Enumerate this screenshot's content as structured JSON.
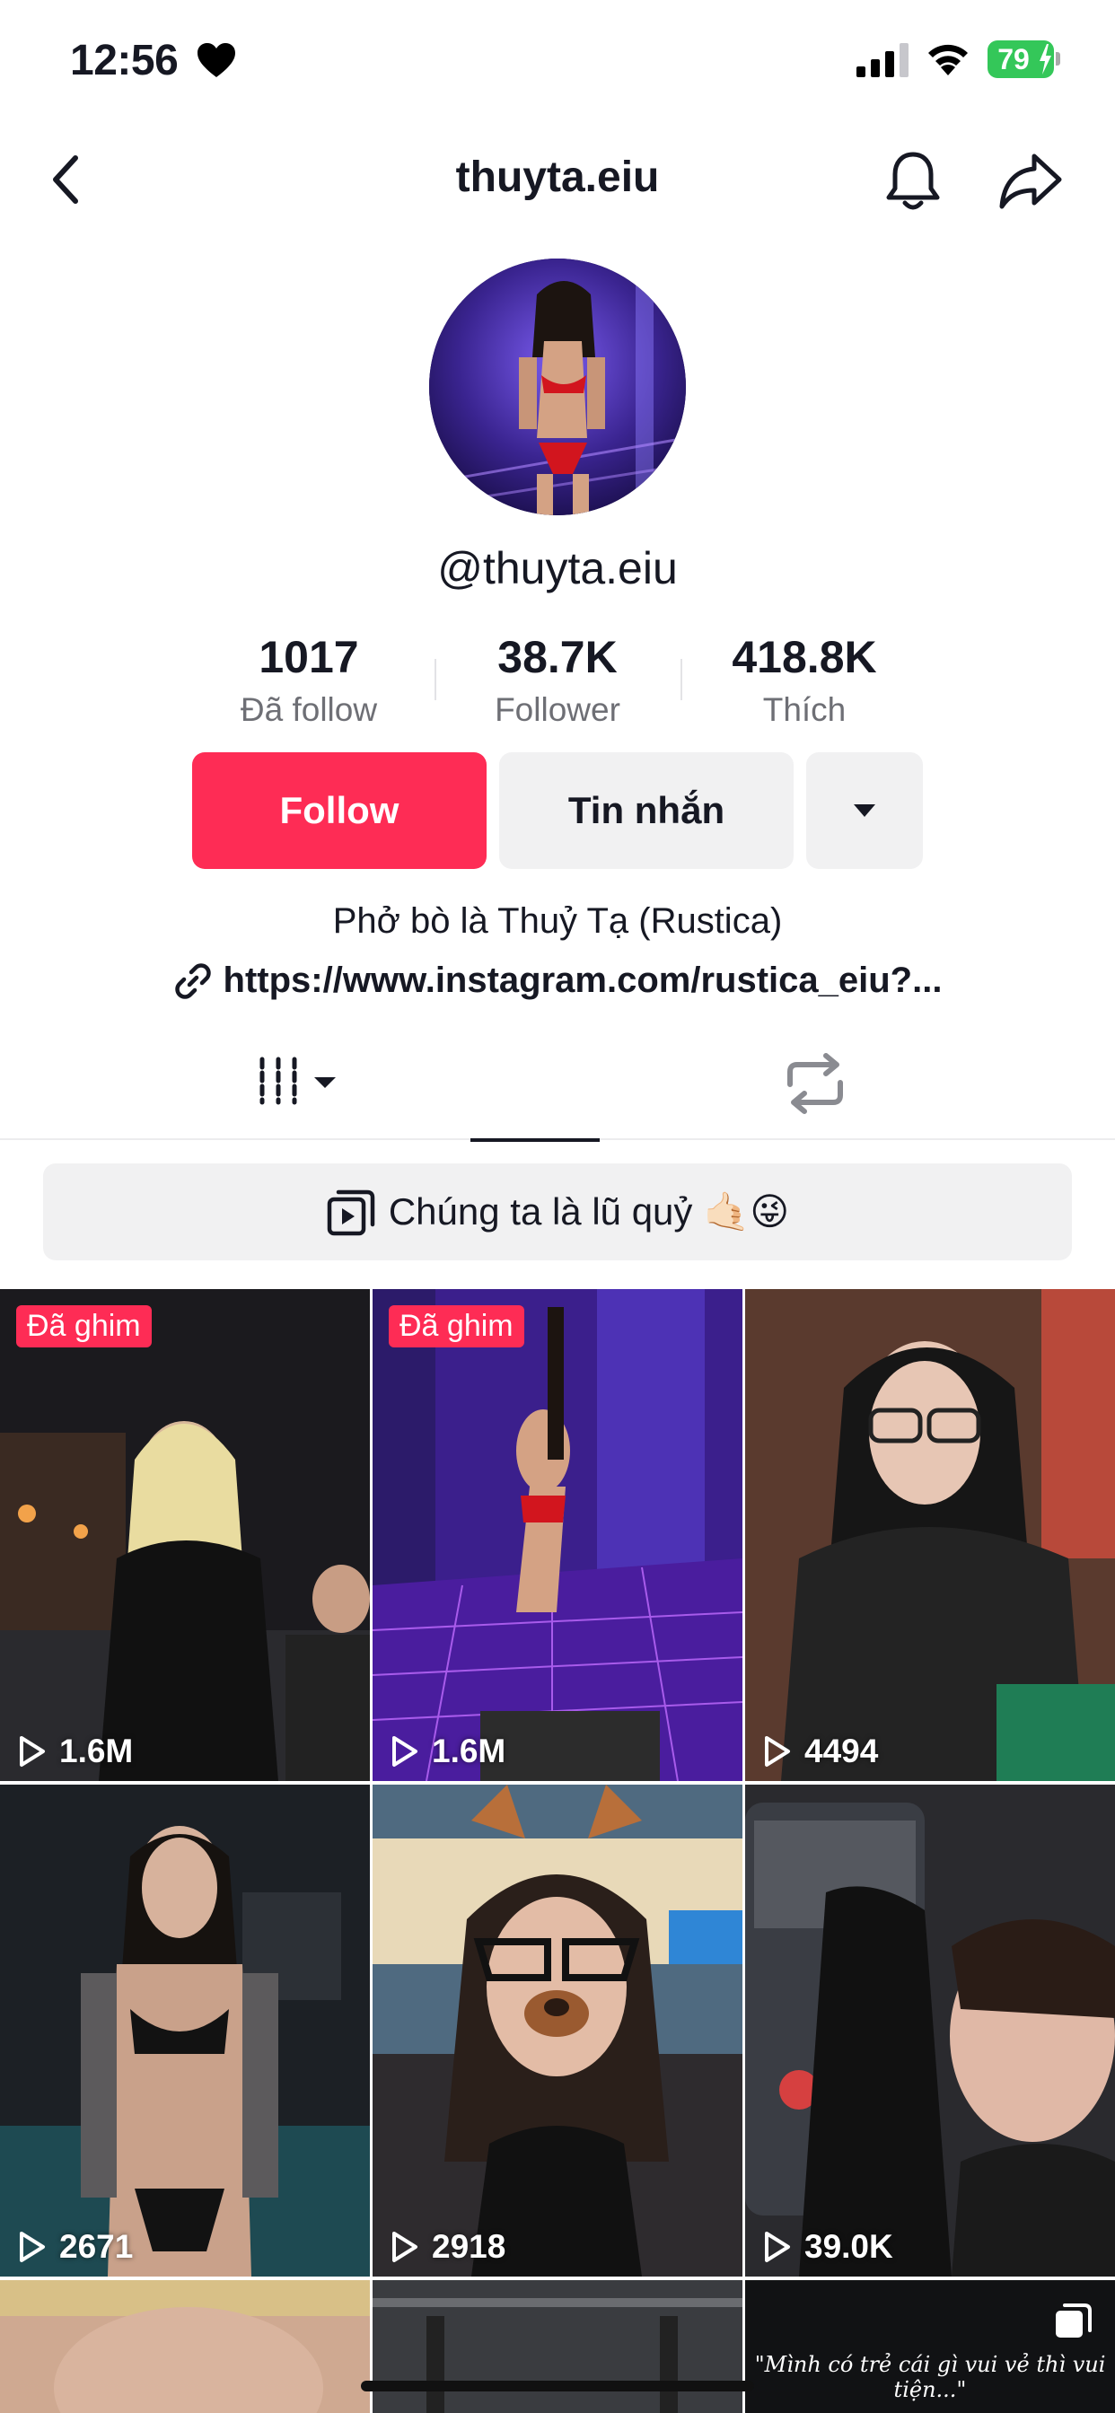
{
  "status_bar": {
    "time": "12:56",
    "battery": "79"
  },
  "header": {
    "title": "thuyta.eiu"
  },
  "profile": {
    "handle": "@thuyta.eiu",
    "stats": [
      {
        "value": "1017",
        "label": "Đã follow"
      },
      {
        "value": "38.7K",
        "label": "Follower"
      },
      {
        "value": "418.8K",
        "label": "Thích"
      }
    ],
    "buttons": {
      "follow": "Follow",
      "message": "Tin nhắn"
    },
    "bio": "Phở bò là Thuỷ Tạ (Rustica)",
    "link": "https://www.instagram.com/rustica_eiu?..."
  },
  "playlist": {
    "label": "Chúng ta là lũ quỷ 🤙🏻😜"
  },
  "videos": [
    {
      "pinned_label": "Đã ghim",
      "views": "1.6M"
    },
    {
      "pinned_label": "Đã ghim",
      "views": "1.6M"
    },
    {
      "views": "4494"
    },
    {
      "views": "2671"
    },
    {
      "views": "2918"
    },
    {
      "views": "39.0K"
    },
    {
      "views": ""
    },
    {
      "views": ""
    },
    {
      "views": "",
      "caption": "\"Mình có trẻ cái gì vui vẻ thì vui tiện...\""
    }
  ],
  "colors": {
    "accent": "#fe2c55",
    "secondary_button": "#f1f1f2",
    "battery": "#34c759"
  }
}
